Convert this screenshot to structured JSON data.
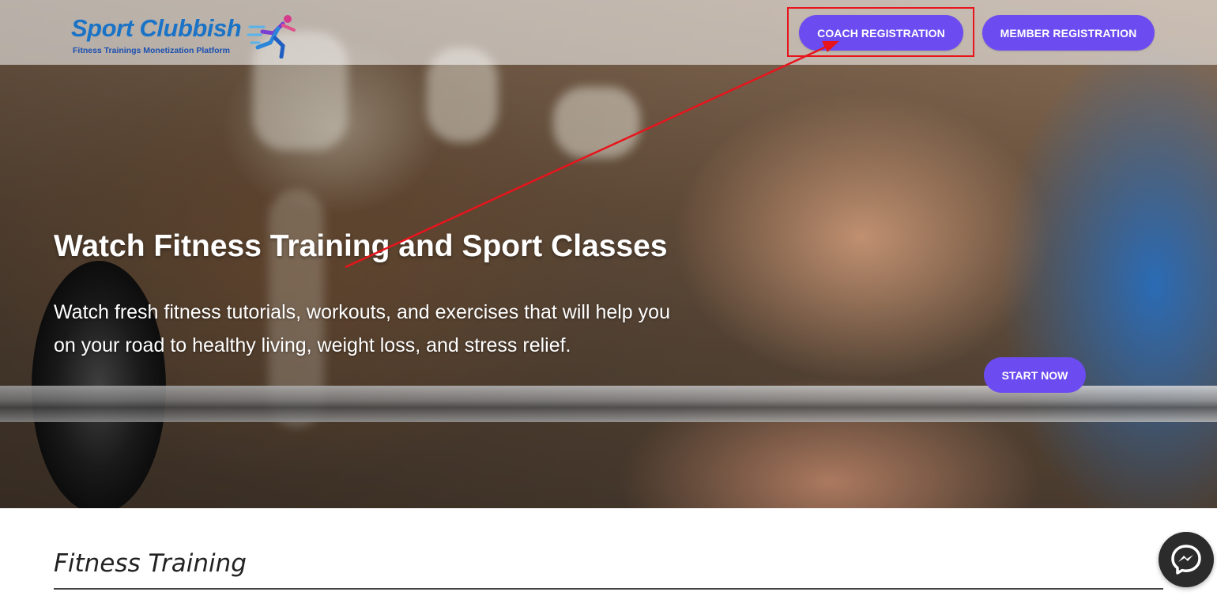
{
  "header": {
    "logo_title": "Sport Clubbish",
    "logo_subtitle": "Fitness Trainings Monetization Platform",
    "coach_registration_label": "COACH REGISTRATION",
    "member_registration_label": "MEMBER REGISTRATION"
  },
  "hero": {
    "title": "Watch Fitness Training and Sport Classes",
    "description": "Watch fresh fitness tutorials, workouts, and exercises that will help you on your road to healthy living, weight loss, and stress relief.",
    "start_button_label": "START NOW"
  },
  "section": {
    "title": "Fitness Training"
  },
  "colors": {
    "button_purple": "#6c4cf0",
    "annotation_red": "#e8141c",
    "logo_blue": "#1a73c6"
  },
  "icons": {
    "logo": "runner-icon",
    "chat": "messenger-icon"
  }
}
